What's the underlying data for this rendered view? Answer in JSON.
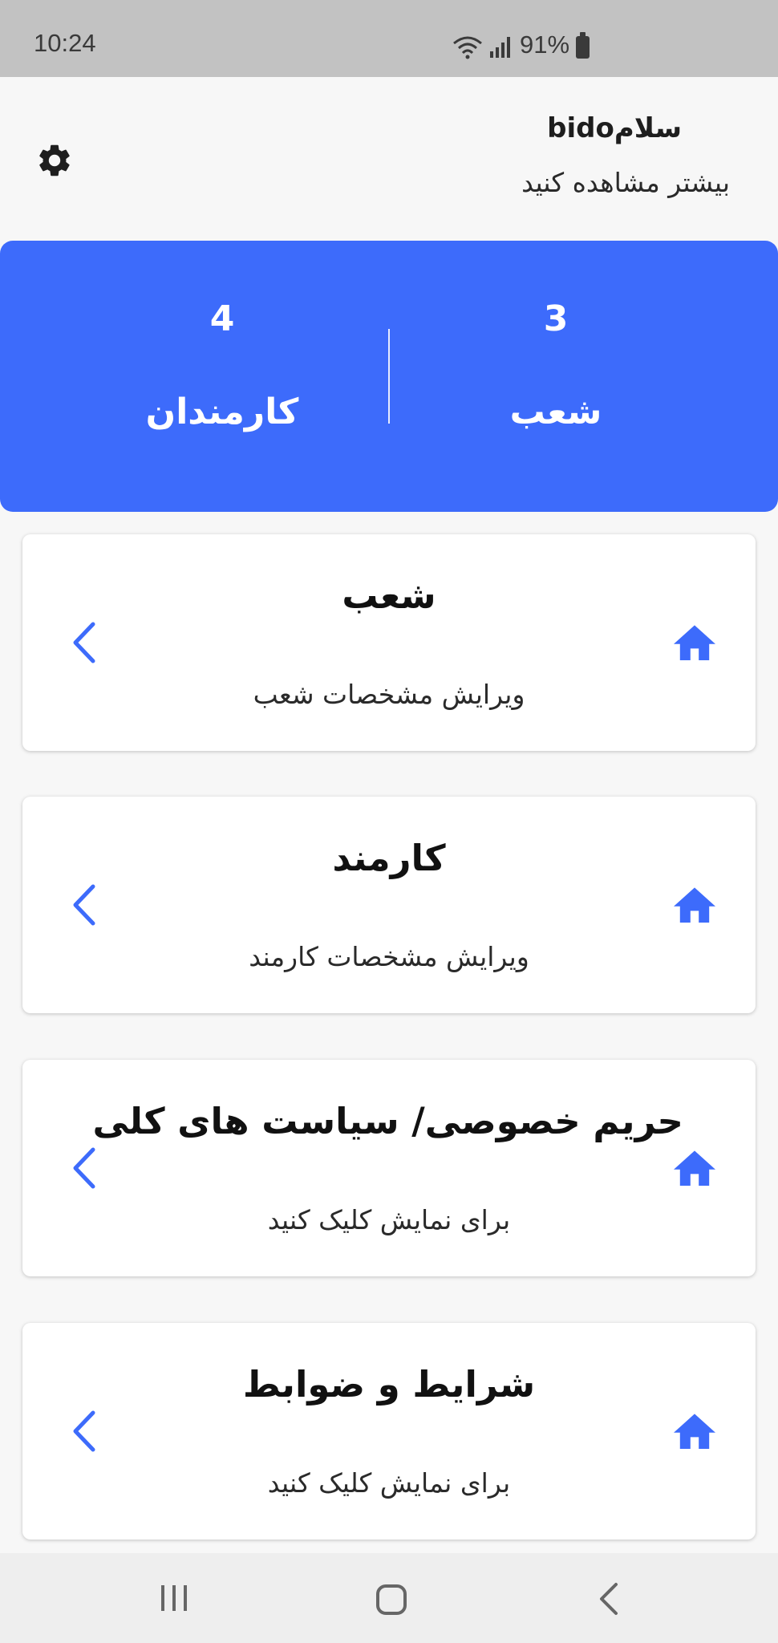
{
  "status_bar": {
    "time": "10:24",
    "battery": "91%",
    "icons": [
      "wifi-icon",
      "signal-icon",
      "battery-icon"
    ]
  },
  "header": {
    "greeting": "سلامbido",
    "subtitle": "بیشتر مشاهده کنید",
    "settings_icon": "gear-icon"
  },
  "stats": {
    "branches": {
      "value": "3",
      "label": "شعب"
    },
    "employees": {
      "value": "4",
      "label": "کارمندان"
    }
  },
  "menu": [
    {
      "title": "شعب",
      "subtitle": "ویرایش مشخصات شعب"
    },
    {
      "title": "کارمند",
      "subtitle": "ویرایش مشخصات کارمند"
    },
    {
      "title": "حریم خصوصی/ سیاست های کلی",
      "subtitle": "برای نمایش کلیک کنید"
    },
    {
      "title": "شرایط و ضوابط",
      "subtitle": "برای نمایش کلیک کنید"
    }
  ],
  "colors": {
    "accent": "#3d6bfb",
    "background": "#f7f7f7",
    "status_bar": "#c2c2c2"
  },
  "nav_bar": {
    "icons": [
      "recent-apps-icon",
      "home-button-icon",
      "back-icon"
    ]
  }
}
